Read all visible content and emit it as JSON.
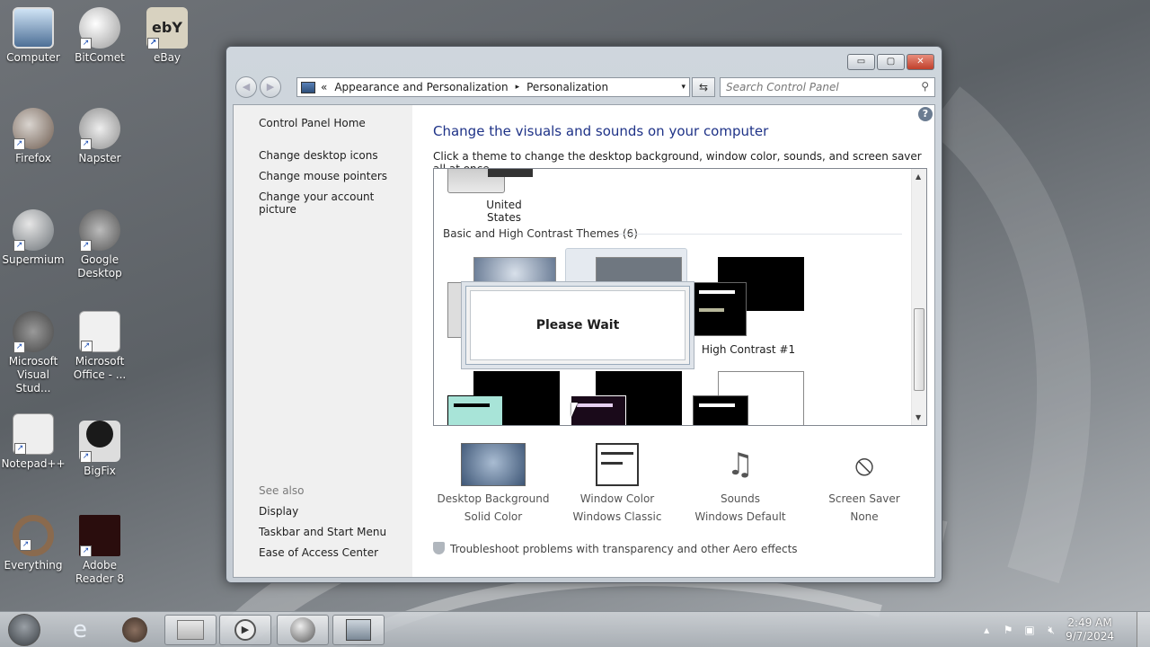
{
  "desktop": {
    "icons": [
      {
        "label": "Computer",
        "icon": "computer-icon"
      },
      {
        "label": "BitComet",
        "icon": "bitcomet-icon"
      },
      {
        "label": "eBay",
        "icon": "ebay-icon"
      },
      {
        "label": "Firefox",
        "icon": "firefox-icon"
      },
      {
        "label": "Napster",
        "icon": "napster-icon"
      },
      {
        "label": "Supermium",
        "icon": "supermium-icon"
      },
      {
        "label": "Google Desktop",
        "icon": "google-desktop-icon"
      },
      {
        "label": "Microsoft Visual Stud...",
        "icon": "visual-studio-icon"
      },
      {
        "label": "Microsoft Office - ...",
        "icon": "office-icon"
      },
      {
        "label": "Notepad++",
        "icon": "notepadpp-icon"
      },
      {
        "label": "BigFix",
        "icon": "bigfix-icon"
      },
      {
        "label": "Everything",
        "icon": "everything-icon"
      },
      {
        "label": "Adobe Reader 8",
        "icon": "adobe-reader-icon"
      }
    ]
  },
  "window": {
    "controls": {
      "minimize": "▭",
      "maximize": "▢",
      "close": "✕"
    },
    "address": {
      "root": "«",
      "crumb1": "Appearance and Personalization",
      "sep": "▸",
      "crumb2": "Personalization",
      "dropdown": "▾"
    },
    "refresh": "⇆",
    "search": {
      "placeholder": "Search Control Panel",
      "icon": "⚲"
    }
  },
  "left_pane": {
    "home": "Control Panel Home",
    "links": [
      "Change desktop icons",
      "Change mouse pointers",
      "Change your account picture"
    ],
    "see_also_title": "See also",
    "see_also": [
      "Display",
      "Taskbar and Start Menu",
      "Ease of Access Center"
    ]
  },
  "main": {
    "help": "?",
    "title": "Change the visuals and sounds on your computer",
    "subtitle": "Click a theme to change the desktop background, window color, sounds, and screen saver all at once.",
    "themes": {
      "top_theme_label": "United States",
      "group_label": "Basic and High Contrast Themes (6)",
      "hc1_label": "High Contrast #1",
      "please_wait": "Please Wait"
    },
    "tools": [
      {
        "title": "Desktop Background",
        "value": "Solid Color",
        "icon": "desktop-background-icon"
      },
      {
        "title": "Window Color",
        "value": "Windows Classic",
        "icon": "window-color-icon"
      },
      {
        "title": "Sounds",
        "value": "Windows Default",
        "icon": "sounds-icon"
      },
      {
        "title": "Screen Saver",
        "value": "None",
        "icon": "screen-saver-icon"
      }
    ],
    "troubleshoot": "Troubleshoot problems with transparency and other Aero effects"
  },
  "taskbar": {
    "clock_time": "2:49 AM",
    "clock_date": "9/7/2024",
    "tray_expand": "▴"
  }
}
